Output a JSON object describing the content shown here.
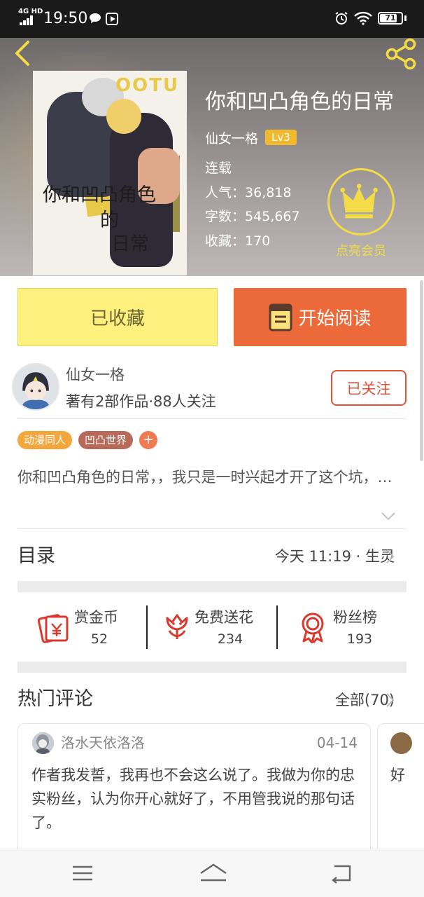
{
  "status_bar": {
    "network": "4G HD",
    "time": "19:50",
    "battery": "71"
  },
  "book": {
    "title": "你和凹凸角色的日常",
    "author": "仙女一格",
    "level": "Lv3",
    "status": "连载",
    "popularity_label": "人气：",
    "popularity": "36,818",
    "words_label": "字数：",
    "words": "545,667",
    "favorites_label": "收藏：",
    "favorites": "170",
    "cover_text": [
      "你和凹凸角色",
      "的",
      "日常"
    ],
    "cover_logo": "OOTU"
  },
  "vip": {
    "label": "点亮会员"
  },
  "actions": {
    "collected": "已收藏",
    "start_reading": "开始阅读"
  },
  "author": {
    "name": "仙女一格",
    "stats": "著有2部作品·88人关注",
    "follow": "已关注"
  },
  "tags": [
    {
      "label": "动漫同人",
      "color": "#f3a63b"
    },
    {
      "label": "凹凸世界",
      "color": "#b86a5a"
    }
  ],
  "tag_add": "+",
  "intro": "你和凹凸角色的日常，，我只是一时兴起才开了这个坑，…",
  "catalog": {
    "title": "目录",
    "update": "今天 11:19 · 生灵"
  },
  "stats": [
    {
      "label": "赏金币",
      "value": "52",
      "icon": "red-envelope-yen-icon"
    },
    {
      "label": "免费送花",
      "value": "234",
      "icon": "flower-icon"
    },
    {
      "label": "粉丝榜",
      "value": "193",
      "icon": "medal-icon"
    }
  ],
  "comments": {
    "title": "热门评论",
    "all": "全部(70)",
    "items": [
      {
        "user": "洛水天依洛洛",
        "date": "04-14",
        "text": "作者我发誓，我再也不会这么说了。我做为你的忠实粉丝，认为你开心就好了，不用管我说的那句话了。"
      },
      {
        "text": "好"
      }
    ]
  },
  "colors": {
    "accent_orange": "#ec6a3a",
    "collected_yellow": "#fdf07d",
    "vip_gold": "#f3dc45",
    "follow_red": "#e0533a"
  }
}
